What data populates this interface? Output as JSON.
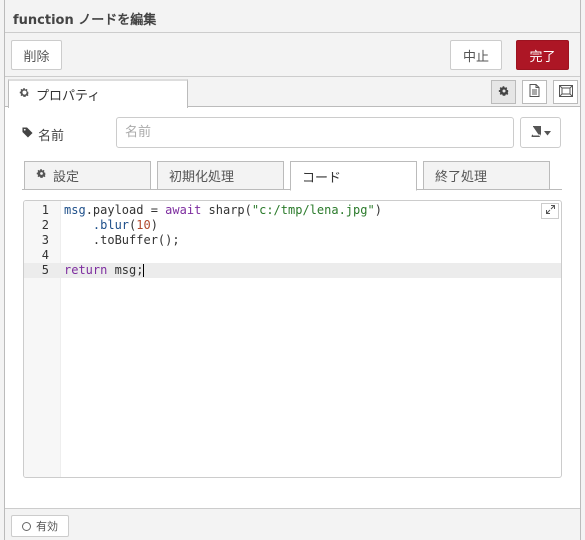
{
  "header": {
    "title": "function ノードを編集"
  },
  "toolbar": {
    "delete_label": "削除",
    "cancel_label": "中止",
    "done_label": "完了"
  },
  "tabs": {
    "properties_label": "プロパティ",
    "icons": [
      "gear-icon",
      "file-icon",
      "layout-icon"
    ]
  },
  "name_field": {
    "label": "名前",
    "placeholder": "名前",
    "value": ""
  },
  "subtabs": [
    {
      "label": "設定",
      "icon": "gear-icon"
    },
    {
      "label": "初期化処理"
    },
    {
      "label": "コード",
      "active": true
    },
    {
      "label": "終了処理"
    }
  ],
  "editor": {
    "line_numbers": [
      "1",
      "2",
      "3",
      "4",
      "5"
    ],
    "lines": [
      "msg.payload = await sharp(\"c:/tmp/lena.jpg\")",
      "    .blur(10)",
      "    .toBuffer();",
      "",
      "return msg;"
    ],
    "active_line": 5
  },
  "footer": {
    "enable_label": "有効"
  },
  "colors": {
    "accent": "#ad1625",
    "keyword": "#7d2d9f",
    "string": "#2a7a2a",
    "number": "#b0482c"
  }
}
